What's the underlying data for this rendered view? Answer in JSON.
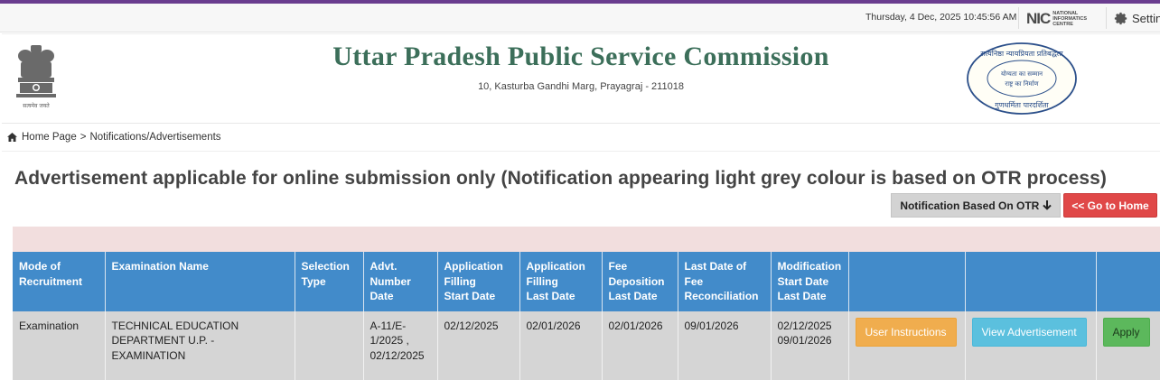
{
  "topbar": {
    "datetime": "Thursday, 4 Dec, 2025 10:45:56 AM",
    "nic_logo_big": "NIC",
    "nic_logo_small": [
      "NATIONAL",
      "INFORMATICS",
      "CENTRE"
    ],
    "settings_label": "Settin"
  },
  "header": {
    "title": "Uttar Pradesh Public Service Commission",
    "address": "10, Kasturba Gandhi Marg, Prayagraj - 211018",
    "emblem_caption": "सत्यमेव जयते",
    "seal_top_text": "सत्यनिष्ठा न्यायप्रियता प्रतिबद्धता",
    "seal_middle_text_1": "योग्यता का सम्मान",
    "seal_middle_text_2": "राष्ट्र का निर्माण",
    "seal_bottom_text": "गुणधर्मिता पारदर्शिता"
  },
  "breadcrumb": {
    "home": "Home Page",
    "separator": ">",
    "current": "Notifications/Advertisements"
  },
  "page_heading": "Advertisement applicable for online submission only (Notification appearing light grey colour is based on OTR process)",
  "buttons": {
    "otr": "Notification Based On OTR",
    "go_home": "<< Go to Home"
  },
  "table": {
    "headers": [
      [
        "Mode of",
        "Recruitment"
      ],
      [
        "Examination Name"
      ],
      [
        "Selection",
        "Type"
      ],
      [
        "Advt.",
        "Number",
        "Date"
      ],
      [
        "Application",
        "Filling",
        "Start Date"
      ],
      [
        "Application",
        "Filling",
        "Last Date"
      ],
      [
        "Fee",
        "Deposition",
        "Last Date"
      ],
      [
        "Last Date of",
        "Fee",
        "Reconciliation"
      ],
      [
        "Modification",
        "Start Date",
        "Last Date"
      ],
      [],
      [],
      []
    ],
    "rows": [
      {
        "mode": "Examination",
        "exam_name": "TECHNICAL EDUCATION DEPARTMENT U.P. - EXAMINATION",
        "selection_type": "",
        "advt_number": "A-11/E-1/2025",
        "advt_date": "02/12/2025",
        "app_start": "02/12/2025",
        "app_last": "02/01/2026",
        "fee_last": "02/01/2026",
        "fee_recon": "09/01/2026",
        "mod_start": "02/12/2025",
        "mod_last": "09/01/2026",
        "btn_instructions": "User Instructions",
        "btn_view": "View Advertisement",
        "btn_apply": "Apply"
      }
    ]
  },
  "colors": {
    "top_strip": "#6a3d8f",
    "title_green": "#3c6f5a",
    "table_header": "#428bca",
    "pink_bar": "#f2dede",
    "row_grey": "#d5d5d5",
    "home_red": "#e04848"
  },
  "icons": [
    "gear-icon",
    "home-icon",
    "arrow-down-icon",
    "state-emblem",
    "commission-seal"
  ]
}
